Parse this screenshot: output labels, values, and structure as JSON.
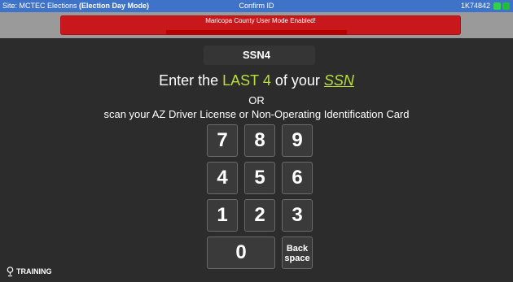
{
  "topbar": {
    "site_prefix": "Site: MCTEC Elections ",
    "site_mode": "(Election Day Mode)",
    "screen_title": "Confirm ID",
    "device_id": "1K74842"
  },
  "banner": {
    "message": "Maricopa County User Mode Enabled!"
  },
  "step": {
    "title": "SSN4"
  },
  "prompt": {
    "pre": "Enter the ",
    "highlight": "LAST 4",
    "mid": " of your ",
    "link": "SSN",
    "or": "OR",
    "scan": "scan your AZ Driver License or Non-Operating Identification Card"
  },
  "keypad": {
    "k7": "7",
    "k8": "8",
    "k9": "9",
    "k4": "4",
    "k5": "5",
    "k6": "6",
    "k1": "1",
    "k2": "2",
    "k3": "3",
    "k0": "0",
    "back_line1": "Back",
    "back_line2": "space"
  },
  "footer": {
    "training": "TRAINING"
  },
  "colors": {
    "topbar": "#3f73c8",
    "banner": "#c8181c",
    "accent_green": "#b9e03a",
    "background": "#2c2c2c"
  }
}
